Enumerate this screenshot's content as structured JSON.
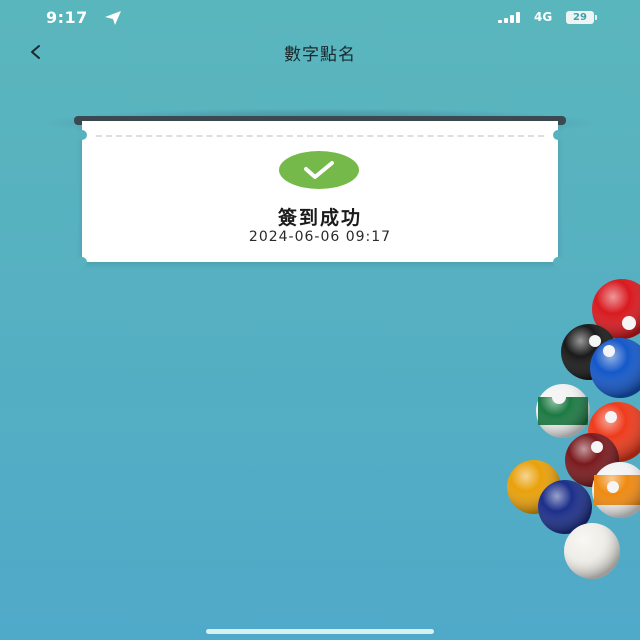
{
  "status_bar": {
    "time": "9:17",
    "network": "4G",
    "battery": "29",
    "icons": [
      "location-arrow-icon",
      "signal-icon",
      "battery-icon"
    ]
  },
  "nav": {
    "back_label": "<",
    "title": "數字點名"
  },
  "card": {
    "icon": "check-icon",
    "title": "簽到成功",
    "timestamp": "2024-06-06 09:17"
  },
  "colors": {
    "background": "#55afc2",
    "success_green": "#74b94a",
    "card": "#ffffff",
    "slot": "#3b4a52"
  }
}
